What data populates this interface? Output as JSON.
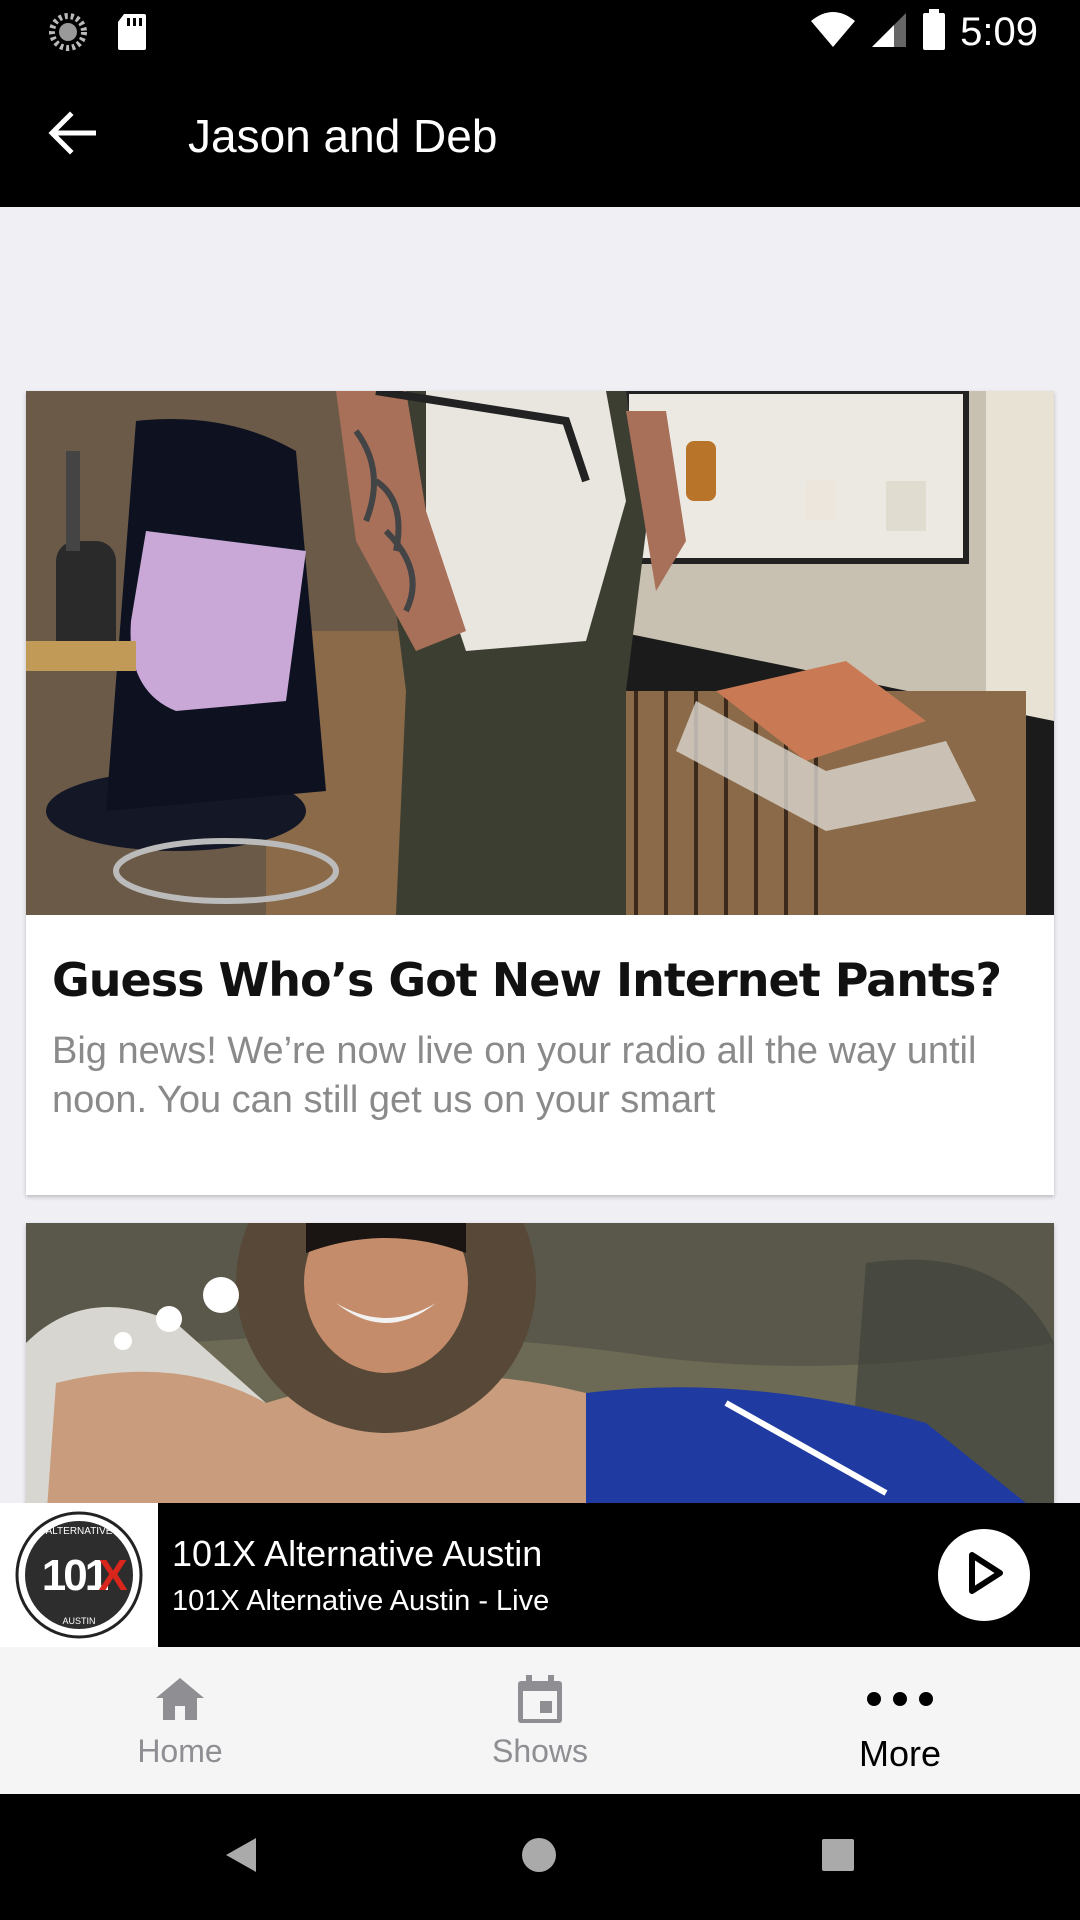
{
  "status_bar": {
    "time": "5:09",
    "icons": [
      "sync-icon",
      "sd-card-icon",
      "wifi-icon",
      "signal-icon",
      "battery-icon"
    ]
  },
  "app_bar": {
    "title": "Jason and Deb",
    "back_icon": "arrow-back-icon"
  },
  "articles": [
    {
      "title": "Guess Who’s Got New Internet Pants?",
      "excerpt": "Big news! We’re now live on your radio all the way until noon.  You can still get us on your smart",
      "image_description": "photo"
    },
    {
      "title": "",
      "excerpt": "",
      "image_description": "photo"
    }
  ],
  "player": {
    "logo_text": "101X",
    "logo_ring_top": "ALTERNATIVE",
    "logo_ring_bottom": "AUSTIN",
    "station_name": "101X Alternative Austin",
    "stream_name": "101X Alternative Austin - Live",
    "play_icon": "play-icon"
  },
  "tabs": [
    {
      "label": "Home",
      "icon": "home-icon",
      "active": false
    },
    {
      "label": "Shows",
      "icon": "calendar-icon",
      "active": false
    },
    {
      "label": "More",
      "icon": "more-horizontal-icon",
      "active": true
    }
  ],
  "colors": {
    "bar_background": "#000000",
    "content_background": "#efeff4",
    "tab_inactive": "#8e8e93",
    "tab_active": "#000000",
    "logo_red": "#d9261c"
  }
}
